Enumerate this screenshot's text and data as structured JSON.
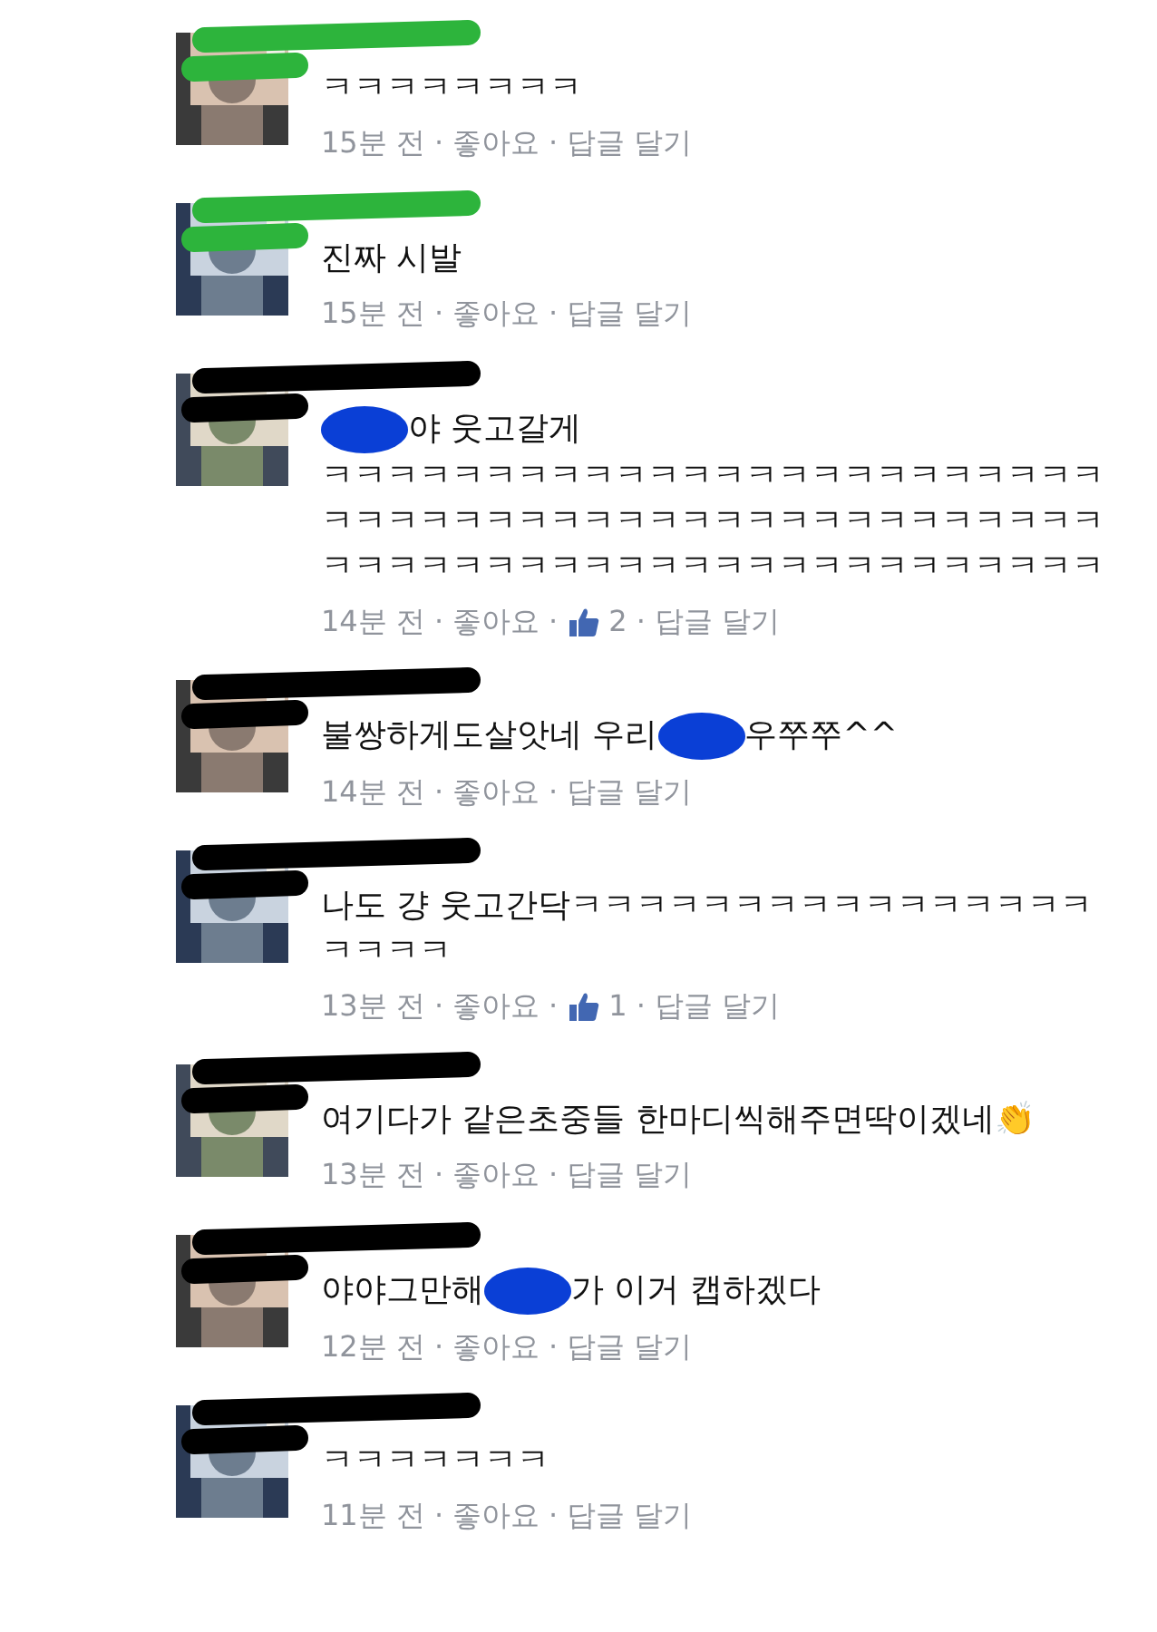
{
  "comments": [
    {
      "color": "#2db43c",
      "lines": [
        [
          {
            "kind": "text",
            "text": "ㅋㅋㅋㅋㅋㅋㅋㅋ"
          }
        ]
      ],
      "meta": [
        {
          "kind": "time",
          "text": "15분 전"
        },
        {
          "kind": "sep",
          "text": "·"
        },
        {
          "kind": "link",
          "text": "좋아요"
        },
        {
          "kind": "sep",
          "text": "·"
        },
        {
          "kind": "link",
          "text": "답글 달기"
        }
      ]
    },
    {
      "color": "#2db43c",
      "lines": [
        [
          {
            "kind": "text",
            "text": "진짜 시발"
          }
        ]
      ],
      "meta": [
        {
          "kind": "time",
          "text": "15분 전"
        },
        {
          "kind": "sep",
          "text": "·"
        },
        {
          "kind": "link",
          "text": "좋아요"
        },
        {
          "kind": "sep",
          "text": "·"
        },
        {
          "kind": "link",
          "text": "답글 달기"
        }
      ]
    },
    {
      "color": "#000000",
      "lines": [
        [
          {
            "kind": "redaction",
            "color": "#0a3fd6"
          },
          {
            "kind": "text",
            "text": "야 웃고갈게"
          }
        ],
        [
          {
            "kind": "text",
            "text": "ㅋㅋㅋㅋㅋㅋㅋㅋㅋㅋㅋㅋㅋㅋㅋㅋㅋㅋㅋㅋㅋㅋㅋㅋㅋㅋㅋㅋㅋㅋㅋㅋㅋㅋㅋㅋㅋㅋㅋㅋㅋㅋㅋㅋㅋㅋㅋㅋㅋㅋㅋㅋㅋㅋㅋㅋㅋㅋㅋㅋㅋㅋㅋㅋㅋㅋㅋㅋㅋㅋㅋㅋ"
          }
        ]
      ],
      "meta": [
        {
          "kind": "time",
          "text": "14분 전"
        },
        {
          "kind": "sep",
          "text": "·"
        },
        {
          "kind": "link",
          "text": "좋아요"
        },
        {
          "kind": "sep",
          "text": "·"
        },
        {
          "kind": "likes",
          "text": "2"
        },
        {
          "kind": "sep",
          "text": "·"
        },
        {
          "kind": "link",
          "text": "답글 달기"
        }
      ]
    },
    {
      "color": "#000000",
      "lines": [
        [
          {
            "kind": "text",
            "text": "불쌍하게도살앗네 우리"
          },
          {
            "kind": "redaction",
            "color": "#0a3fd6"
          },
          {
            "kind": "text",
            "text": "우쭈쭈^^"
          }
        ]
      ],
      "meta": [
        {
          "kind": "time",
          "text": "14분 전"
        },
        {
          "kind": "sep",
          "text": "·"
        },
        {
          "kind": "link",
          "text": "좋아요"
        },
        {
          "kind": "sep",
          "text": "·"
        },
        {
          "kind": "link",
          "text": "답글 달기"
        }
      ]
    },
    {
      "color": "#000000",
      "lines": [
        [
          {
            "kind": "text",
            "text": "나도 걍 웃고간닥ㅋㅋㅋㅋㅋㅋㅋㅋㅋㅋㅋㅋㅋㅋㅋㅋㅋㅋㅋㅋ"
          }
        ]
      ],
      "meta": [
        {
          "kind": "time",
          "text": "13분 전"
        },
        {
          "kind": "sep",
          "text": "·"
        },
        {
          "kind": "link",
          "text": "좋아요"
        },
        {
          "kind": "sep",
          "text": "·"
        },
        {
          "kind": "likes",
          "text": "1"
        },
        {
          "kind": "sep",
          "text": "·"
        },
        {
          "kind": "link",
          "text": "답글 달기"
        }
      ]
    },
    {
      "color": "#000000",
      "lines": [
        [
          {
            "kind": "text",
            "text": "여기다가 같은초중들 한마디씩해주면딱이겠네👏"
          }
        ]
      ],
      "meta": [
        {
          "kind": "time",
          "text": "13분 전"
        },
        {
          "kind": "sep",
          "text": "·"
        },
        {
          "kind": "link",
          "text": "좋아요"
        },
        {
          "kind": "sep",
          "text": "·"
        },
        {
          "kind": "link",
          "text": "답글 달기"
        }
      ]
    },
    {
      "color": "#000000",
      "lines": [
        [
          {
            "kind": "text",
            "text": "야야그만해"
          },
          {
            "kind": "redaction",
            "color": "#0a3fd6"
          },
          {
            "kind": "text",
            "text": "가 이거 캡하겠다"
          }
        ]
      ],
      "meta": [
        {
          "kind": "time",
          "text": "12분 전"
        },
        {
          "kind": "sep",
          "text": "·"
        },
        {
          "kind": "link",
          "text": "좋아요"
        },
        {
          "kind": "sep",
          "text": "·"
        },
        {
          "kind": "link",
          "text": "답글 달기"
        }
      ]
    },
    {
      "color": "#000000",
      "lines": [
        [
          {
            "kind": "text",
            "text": "ㅋㅋㅋㅋㅋㅋㅋ"
          }
        ]
      ],
      "meta": [
        {
          "kind": "time",
          "text": "11분 전"
        },
        {
          "kind": "sep",
          "text": "·"
        },
        {
          "kind": "link",
          "text": "좋아요"
        },
        {
          "kind": "sep",
          "text": "·"
        },
        {
          "kind": "link",
          "text": "답글 달기"
        }
      ]
    }
  ]
}
